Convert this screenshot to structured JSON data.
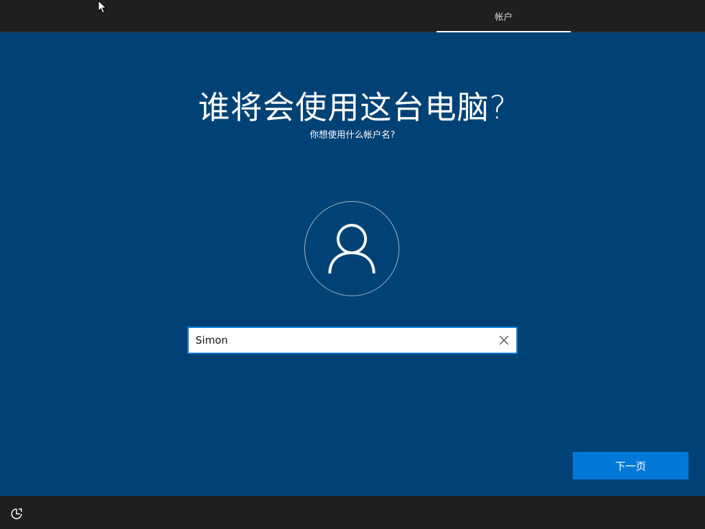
{
  "header": {
    "tabs": [
      {
        "label": "帐户",
        "active": true
      }
    ]
  },
  "main": {
    "title": "谁将会使用这台电脑?",
    "subtitle": "你想使用什么帐户名?",
    "avatar_icon": "user-icon",
    "username_input": {
      "value": "Simon",
      "placeholder": ""
    },
    "clear_icon": "close-icon"
  },
  "footer": {
    "next_label": "下一页",
    "ease_of_access_icon": "ease-of-access-icon"
  },
  "colors": {
    "background": "#004275",
    "bar": "#1f1f1f",
    "accent": "#0078d7",
    "text": "#ffffff"
  }
}
